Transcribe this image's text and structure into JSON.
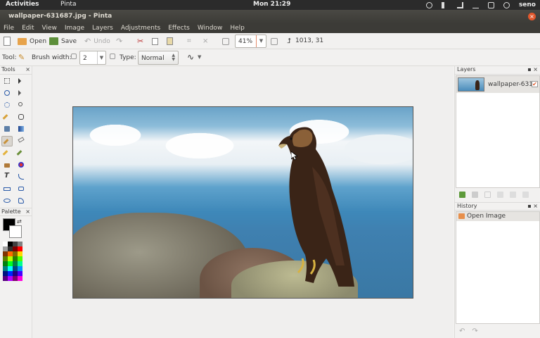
{
  "system": {
    "activities": "Activities",
    "app": "Pinta",
    "clock": "Mon 21:29",
    "user": "seno"
  },
  "window": {
    "title": "wallpaper-631687.jpg - Pinta",
    "close": "×"
  },
  "menu": [
    "File",
    "Edit",
    "View",
    "Image",
    "Layers",
    "Adjustments",
    "Effects",
    "Window",
    "Help"
  ],
  "toolbar": {
    "open": "Open",
    "save": "Save",
    "undo": "Undo",
    "zoom": "41%",
    "coords": "1013, 31"
  },
  "options": {
    "tool_label": "Tool:",
    "brush_width_label": "Brush width:",
    "brush_width": "2",
    "type_label": "Type:",
    "type_value": "Normal"
  },
  "tools_panel": {
    "title": "Tools",
    "close": "×"
  },
  "palette_panel": {
    "title": "Palette",
    "close": "×"
  },
  "palette_colors": [
    "#ffffff",
    "#000000",
    "#404040",
    "#808080",
    "#a0a0a0",
    "#303030",
    "#7f0000",
    "#ff0000",
    "#7f3300",
    "#ff6a00",
    "#7f6a00",
    "#ffd800",
    "#5b7f00",
    "#b6ff00",
    "#267f00",
    "#4cff00",
    "#007f0e",
    "#00ff21",
    "#007f46",
    "#00ff90",
    "#007f7f",
    "#00ffff",
    "#004a7f",
    "#0094ff",
    "#00137f",
    "#0026ff",
    "#21007f",
    "#4800ff",
    "#57007f",
    "#b200ff",
    "#7f006e",
    "#ff00dc"
  ],
  "layers_panel": {
    "title": "Layers",
    "layer_name": "wallpaper-631",
    "visible_mark": "✔"
  },
  "history_panel": {
    "title": "History",
    "items": [
      "Open Image"
    ]
  },
  "colors": {
    "accent": "#e3582d",
    "titlebar": "#3c3b37",
    "panel_bg": "#f2f1f0"
  }
}
